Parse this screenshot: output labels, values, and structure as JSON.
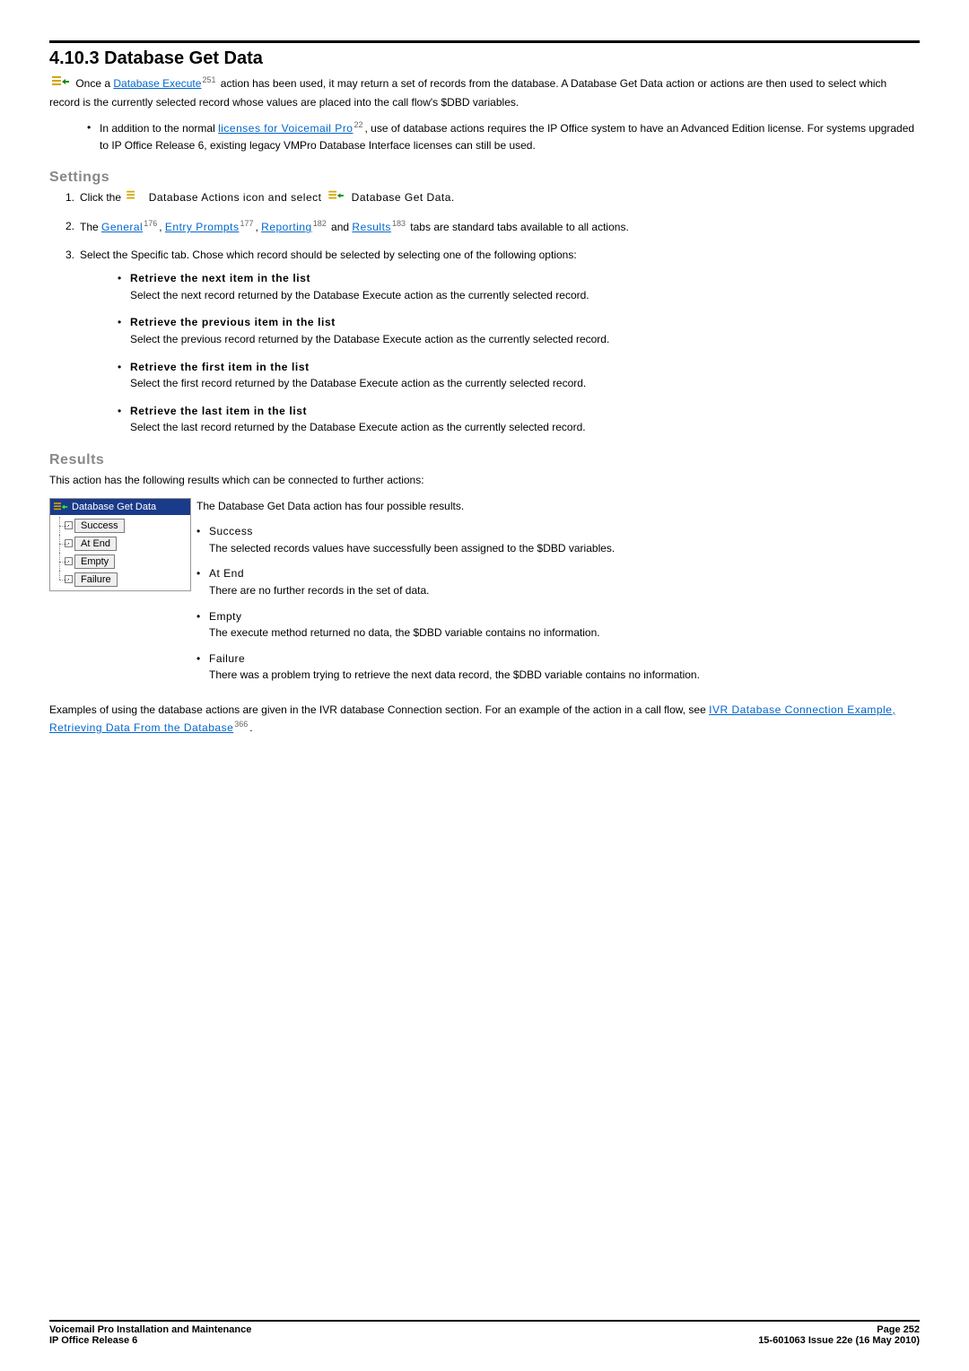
{
  "heading": "4.10.3 Database Get Data",
  "intro_pre": "Once a ",
  "intro_link1": "Database Execute",
  "intro_sup1": "251",
  "intro_post": " action has been used, it may return a set of records from the database. A Database Get Data action or actions are then used to select which record is the currently selected record whose values are placed into the call flow's $DBD variables.",
  "license_bullet_pre": "In addition to the normal ",
  "license_bullet_link": "licenses for Voicemail Pro",
  "license_bullet_sup": "22",
  "license_bullet_post": ", use of database actions requires the IP Office system to have an Advanced Edition license. For systems upgraded to IP Office Release 6, existing legacy VMPro Database Interface licenses can still be used.",
  "settings_heading": "Settings",
  "step1_pre": "Click the ",
  "step1_mid": " Database Actions icon and select ",
  "step1_post": " Database Get Data.",
  "step2_pre": "The ",
  "step2_link_general": "General",
  "step2_sup_general": "176",
  "step2_link_entry": "Entry Prompts",
  "step2_sup_entry": "177",
  "step2_link_reporting": "Reporting",
  "step2_sup_reporting": "182",
  "step2_link_results": "Results",
  "step2_sup_results": "183",
  "step2_post": " tabs are standard tabs available to all actions.",
  "step3": "Select the Specific tab. Chose which record should be selected by selecting one of the following options:",
  "opt1_title": "Retrieve the next item in the list",
  "opt1_body": "Select the next record returned by the Database Execute action as the currently selected record.",
  "opt2_title": "Retrieve the previous item in the list",
  "opt2_body": "Select the previous record returned by the Database Execute action as the currently selected record.",
  "opt3_title": "Retrieve the first item in the list",
  "opt3_body": "Select the first record returned by the Database Execute action as the currently selected record.",
  "opt4_title": "Retrieve the last item in the list",
  "opt4_body": "Select the last record returned by the Database Execute action as the currently selected record.",
  "results_heading": "Results",
  "results_intro": "This action has the following results which can be connected to further actions:",
  "results_lead": "The Database Get Data action has four possible results.",
  "res_success_title": "Success",
  "res_success_body": "The selected records values have successfully been assigned to the $DBD variables.",
  "res_atend_title": "At End",
  "res_atend_body": "There are no further records in the set of data.",
  "res_empty_title": "Empty",
  "res_empty_body": "The execute method returned no data, the $DBD variable contains no information.",
  "res_failure_title": "Failure",
  "res_failure_body": "There was a problem trying to retrieve the next data record, the $DBD variable contains no information.",
  "example_pre": "Examples of using the database actions are given in the IVR database Connection section. For an example of the action in a call flow, see ",
  "example_link": "IVR Database Connection Example, Retrieving Data From the Database",
  "example_sup": "366",
  "example_post": ".",
  "tree_head": "Database Get Data",
  "tree_items": [
    "Success",
    "At End",
    "Empty",
    "Failure"
  ],
  "footer_left1": "Voicemail Pro Installation and Maintenance",
  "footer_left2": "IP Office Release 6",
  "footer_right1": "Page 252",
  "footer_right2": "15-601063 Issue 22e (16 May 2010)"
}
